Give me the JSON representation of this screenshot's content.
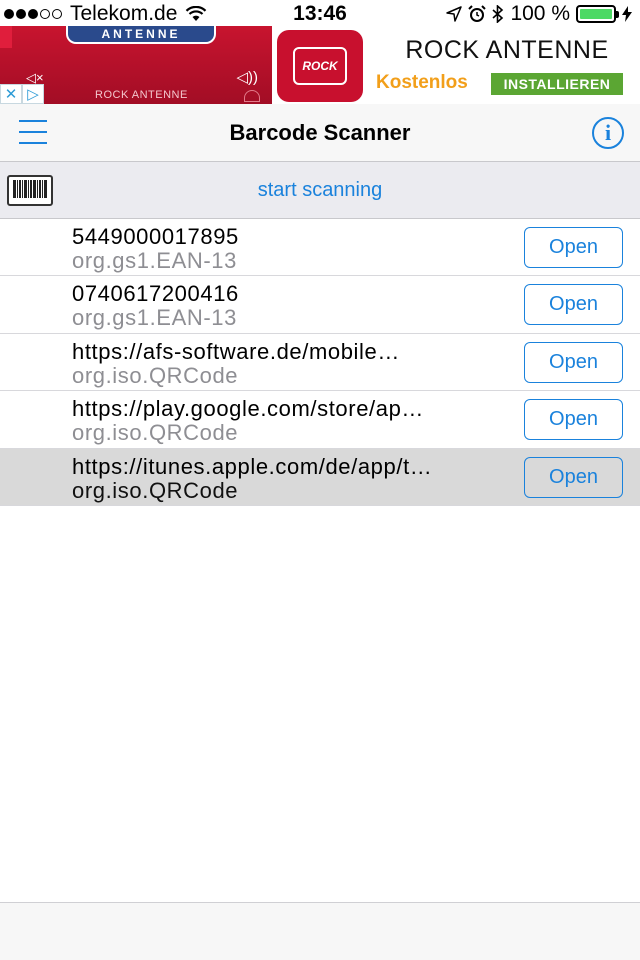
{
  "status_bar": {
    "carrier": "Telekom.de",
    "time": "13:46",
    "battery_percent": "100 %",
    "battery_level": 1.0,
    "signal_dots_filled": 3,
    "signal_dots_total": 5
  },
  "ad": {
    "left_banner_text": "ANTENNE",
    "left_name": "ROCK ANTENNE",
    "title": "ROCK ANTENNE",
    "free_label": "Kostenlos",
    "install_label": "INSTALLIEREN",
    "logo_text": "ROCK"
  },
  "navbar": {
    "title": "Barcode Scanner"
  },
  "scanbar": {
    "label": "start scanning"
  },
  "list": {
    "open_label": "Open",
    "items": [
      {
        "code": "5449000017895",
        "type": "org.gs1.EAN-13",
        "selected": false
      },
      {
        "code": "0740617200416",
        "type": "org.gs1.EAN-13",
        "selected": false
      },
      {
        "code": "https://afs-software.de/mobile…",
        "type": "org.iso.QRCode",
        "selected": false
      },
      {
        "code": "https://play.google.com/store/ap…",
        "type": "org.iso.QRCode",
        "selected": false
      },
      {
        "code": "https://itunes.apple.com/de/app/t…",
        "type": "org.iso.QRCode",
        "selected": true
      }
    ]
  },
  "colors": {
    "accent": "#1a82dc",
    "ad_red": "#c8102e",
    "install_green": "#5ba633",
    "free_orange": "#f29f1a",
    "battery_green": "#4cd964"
  }
}
